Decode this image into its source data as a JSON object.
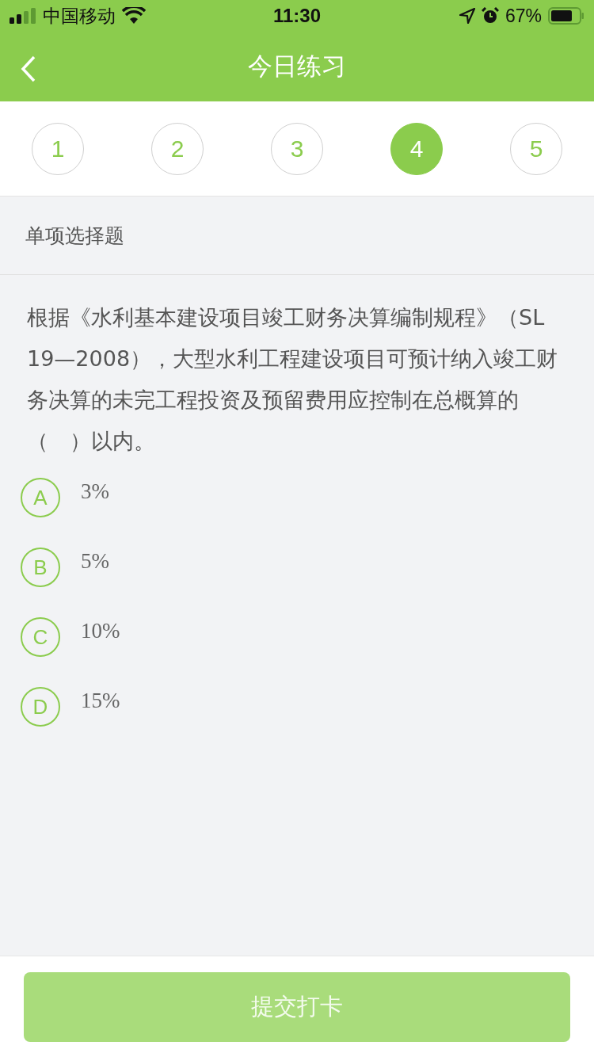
{
  "status_bar": {
    "carrier": "中国移动",
    "time": "11:30",
    "battery": "67%"
  },
  "nav": {
    "title": "今日练习"
  },
  "steps": [
    {
      "label": "1",
      "selected": false
    },
    {
      "label": "2",
      "selected": false
    },
    {
      "label": "3",
      "selected": false
    },
    {
      "label": "4",
      "selected": true
    },
    {
      "label": "5",
      "selected": false
    }
  ],
  "section": {
    "title": "单项选择题"
  },
  "question": {
    "text": "根据《水利基本建设项目竣工财务决算编制规程》（SL 19—2008），大型水利工程建设项目可预计纳入竣工财务决算的未完工程投资及预留费用应控制在总概算的（　）以内。"
  },
  "options": [
    {
      "letter": "A",
      "text": "3%",
      "selected": false
    },
    {
      "letter": "B",
      "text": "5%",
      "selected": false
    },
    {
      "letter": "C",
      "text": "10%",
      "selected": false
    },
    {
      "letter": "D",
      "text": "15%",
      "selected": false
    }
  ],
  "submit": {
    "label": "提交打卡",
    "disabled": true
  }
}
